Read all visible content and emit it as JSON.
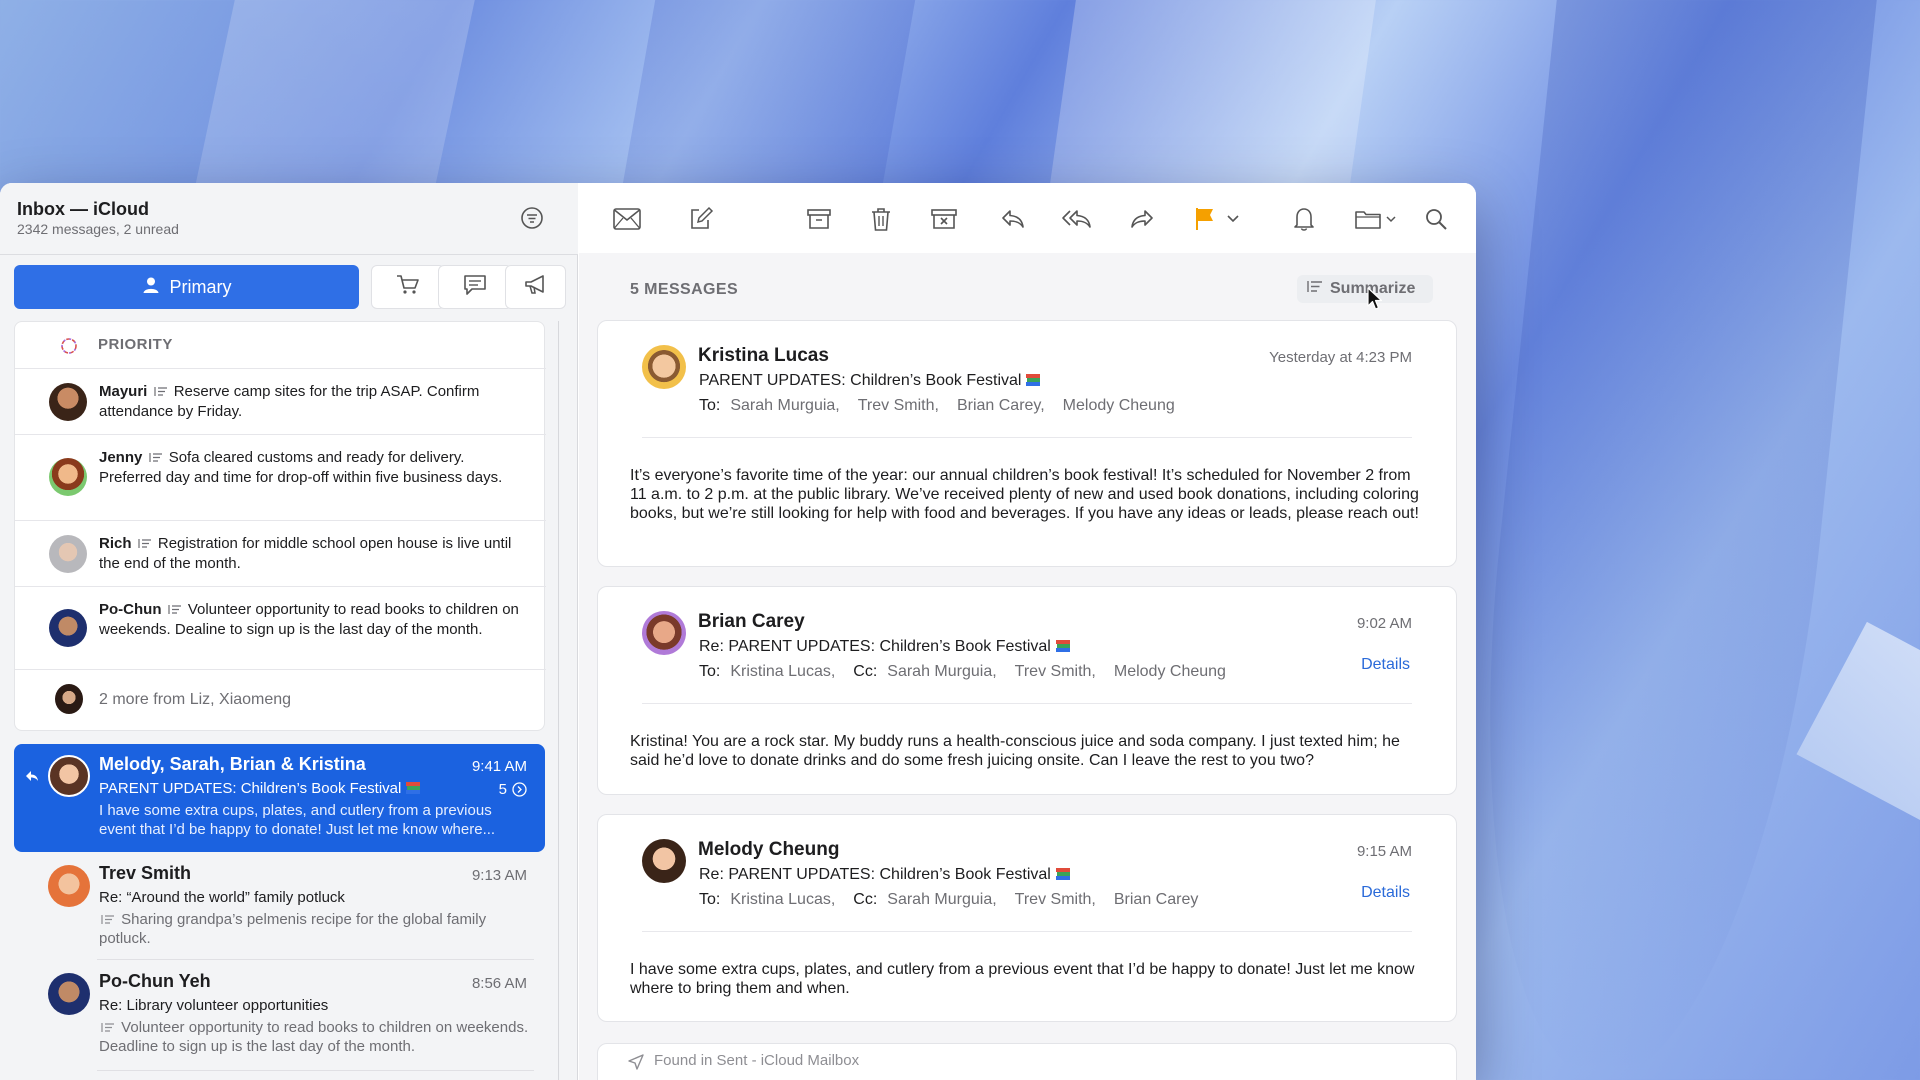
{
  "mailbox": {
    "title": "Inbox — iCloud",
    "subtitle": "2342 messages, 2 unread"
  },
  "tabs": {
    "primary": "Primary"
  },
  "priority": {
    "heading": "PRIORITY",
    "items": [
      {
        "sender": "Mayuri",
        "text": "Reserve camp sites for the trip ASAP. Confirm attendance by Friday."
      },
      {
        "sender": "Jenny",
        "text": "Sofa cleared customs and ready for delivery. Preferred day and time for drop-off within five business days."
      },
      {
        "sender": "Rich",
        "text": "Registration for middle school open house is live until the end of the month."
      },
      {
        "sender": "Po-Chun",
        "text": "Volunteer opportunity to read books to children on weekends. Dealine to sign up is the last day of the month."
      }
    ],
    "more": "2 more from Liz, Xiaomeng"
  },
  "messages": [
    {
      "sender": "Melody, Sarah, Brian & Kristina",
      "time": "9:41 AM",
      "subject": "PARENT UPDATES: Children’s Book Festival",
      "count": "5",
      "preview": "I have some extra cups, plates, and cutlery from a previous event that I’d be happy to donate! Just let me know where..."
    },
    {
      "sender": "Trev Smith",
      "time": "9:13 AM",
      "subject": "Re: “Around the world” family potluck",
      "preview": "Sharing grandpa’s pelmenis recipe for the global family potluck."
    },
    {
      "sender": "Po-Chun Yeh",
      "time": "8:56 AM",
      "subject": "Re: Library volunteer opportunities",
      "preview": "Volunteer opportunity to read books to children on weekends. Deadline to sign up is the last day of the month."
    }
  ],
  "thread": {
    "count_label": "5 MESSAGES",
    "summarize": "Summarize",
    "to_label": "To:",
    "cc_label": "Cc:",
    "details": "Details",
    "cards": [
      {
        "sender": "Kristina Lucas",
        "time": "Yesterday at 4:23 PM",
        "subject": "PARENT UPDATES: Children’s Book Festival",
        "to": [
          "Sarah Murguia,",
          "Trev Smith,",
          "Brian Carey,",
          "Melody Cheung"
        ],
        "body": "It’s everyone’s favorite time of the year: our annual children’s book festival! It’s scheduled for November 2 from 11 a.m. to 2 p.m. at the public library. We’ve received plenty of new and used book donations, including coloring books, but we’re still looking for help with food and beverages. If you have any ideas or leads, please reach out!"
      },
      {
        "sender": "Brian Carey",
        "time": "9:02 AM",
        "subject": "Re: PARENT UPDATES: Children’s Book Festival",
        "to": [
          "Kristina Lucas,"
        ],
        "cc": [
          "Sarah Murguia,",
          "Trev Smith,",
          "Melody Cheung"
        ],
        "body": "Kristina! You are a rock star. My buddy runs a health-conscious juice and soda company. I just texted him; he said he’d love to donate drinks and do some fresh juicing onsite. Can I leave the rest to you two?"
      },
      {
        "sender": "Melody Cheung",
        "time": "9:15 AM",
        "subject": "Re: PARENT UPDATES: Children’s Book Festival",
        "to": [
          "Kristina Lucas,"
        ],
        "cc": [
          "Sarah Murguia,",
          "Trev Smith,",
          "Brian Carey"
        ],
        "body": "I have some extra cups, plates, and cutlery from a previous event that I’d be happy to donate! Just let me know where to bring them and when."
      }
    ],
    "found": "Found in Sent - iCloud Mailbox"
  },
  "colors": {
    "accent": "#2f6fe6",
    "selected": "#1b62e0",
    "flag": "#f5a000",
    "link": "#2a6ad9"
  },
  "icons": [
    "filter-icon",
    "person-icon",
    "cart-icon",
    "chat-icon",
    "megaphone-icon",
    "envelope-icon",
    "compose-icon",
    "archive-icon",
    "trash-icon",
    "junk-icon",
    "reply-icon",
    "reply-all-icon",
    "forward-icon",
    "flag-icon",
    "chevron-down-icon",
    "bell-icon",
    "folder-icon",
    "search-icon",
    "summarize-icon",
    "pointer-cursor-icon",
    "paper-plane-icon"
  ]
}
